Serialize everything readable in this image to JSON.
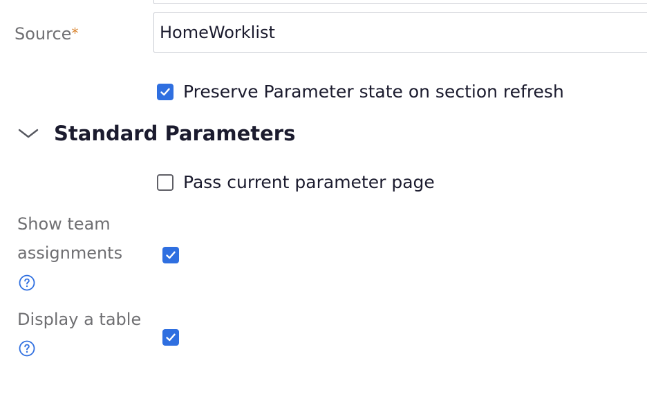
{
  "source": {
    "label": "Source",
    "required_mark": "*",
    "value": "HomeWorklist"
  },
  "preserve_parameter_state": {
    "label": "Preserve Parameter state on section refresh",
    "checked": true
  },
  "standard_parameters": {
    "title": "Standard Parameters",
    "expanded": true,
    "pass_current_parameter_page": {
      "label": "Pass current parameter page",
      "checked": false
    },
    "show_team_assignments": {
      "label_line1": "Show team",
      "label_line2": "assignments",
      "checked": true,
      "help_icon": "question-circle-icon"
    },
    "display_a_table": {
      "label": "Display a table",
      "checked": true,
      "help_icon": "question-circle-icon"
    }
  },
  "colors": {
    "accent": "#2f6fe0",
    "required_star": "#d9822b",
    "label_gray": "#6f6f72",
    "text": "#1b1b2e"
  }
}
